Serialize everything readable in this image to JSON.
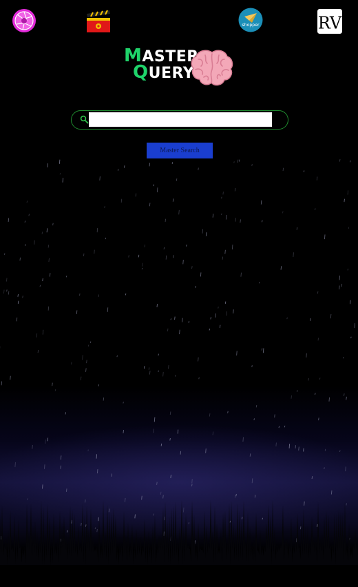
{
  "topbar": {
    "apps": [
      {
        "icon": "camera-aperture-icon"
      },
      {
        "icon": "movie-clapperboard-icon"
      },
      {
        "icon": "shopper-icon",
        "label": "shopper"
      },
      {
        "icon": "rv-monogram-icon",
        "label": "RV"
      }
    ]
  },
  "logo": {
    "line1_cap": "M",
    "line1_rest": "ASTER",
    "line2_cap": "Q",
    "line2_rest": "UERY",
    "icon": "brain-icon"
  },
  "search": {
    "value": "",
    "placeholder": "",
    "button_label": "Master Search"
  },
  "colors": {
    "accent_green": "#1fd36a",
    "button_blue": "#1a3ecf",
    "border_green": "#1f8a2e"
  }
}
